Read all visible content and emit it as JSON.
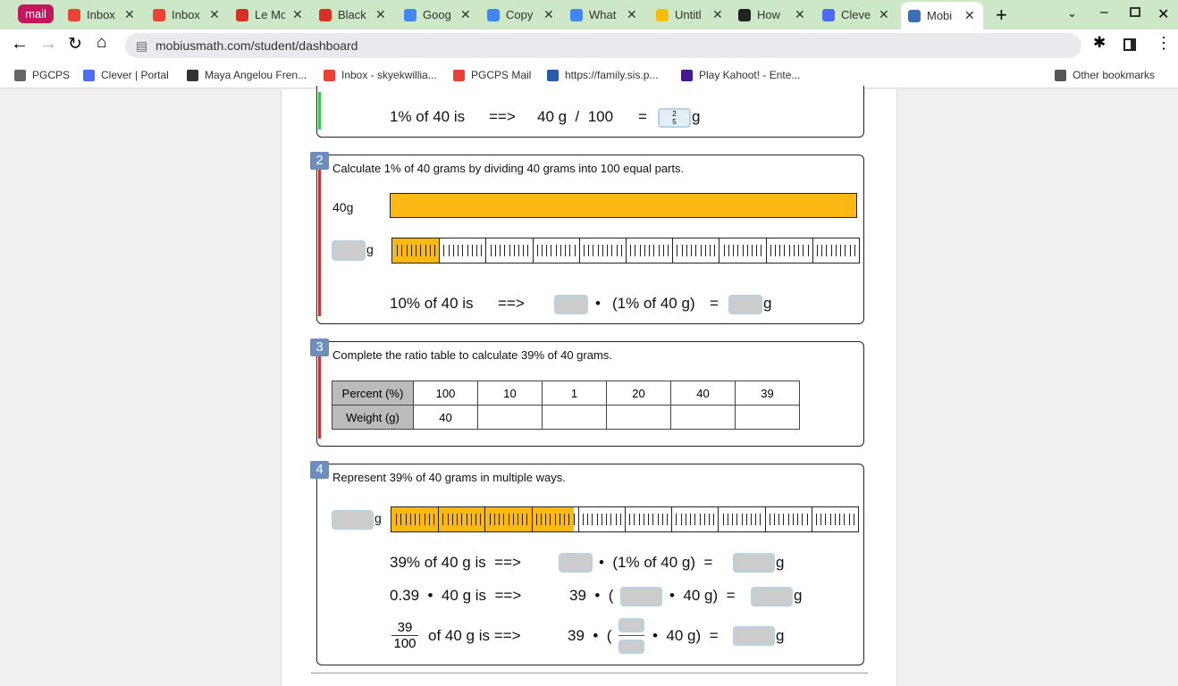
{
  "browser": {
    "pinned_tab": "mail",
    "tabs": [
      {
        "label": "Inbox",
        "color": "#ea4335"
      },
      {
        "label": "Inbox",
        "color": "#ea4335"
      },
      {
        "label": "Le Mo",
        "color": "#d93025"
      },
      {
        "label": "Black",
        "color": "#d93025"
      },
      {
        "label": "Goog",
        "color": "#4285f4"
      },
      {
        "label": "Copy",
        "color": "#4285f4"
      },
      {
        "label": "What",
        "color": "#4285f4"
      },
      {
        "label": "Untitl",
        "color": "#fbbc04"
      },
      {
        "label": "How",
        "color": "#222222"
      },
      {
        "label": "Cleve",
        "color": "#4a6cf7"
      },
      {
        "label": "Mobi",
        "color": "#3b6fb6",
        "active": true
      }
    ],
    "url": "mobiusmath.com/student/dashboard",
    "bookmarks": [
      {
        "label": "PGCPS",
        "color": "#666666"
      },
      {
        "label": "Clever | Portal",
        "color": "#4a6cf7"
      },
      {
        "label": "Maya Angelou Fren...",
        "color": "#333333"
      },
      {
        "label": "Inbox - skyekwillia...",
        "color": "#ea4335"
      },
      {
        "label": "PGCPS Mail",
        "color": "#ea4335"
      },
      {
        "label": "https://family.sis.p...",
        "color": "#2a5caa"
      },
      {
        "label": "Play Kahoot! - Ente...",
        "color": "#46178f"
      }
    ],
    "other_bookmarks": "Other bookmarks"
  },
  "q1": {
    "eq_left": "1% of 40 is",
    "arrow": "==>",
    "eq_mid": "40 g  /  100",
    "equals": "=",
    "answer_num": "2",
    "answer_den": "5",
    "unit": "g"
  },
  "q2": {
    "number": "2",
    "prompt": "Calculate 1% of 40 grams by dividing 40 grams into 100 equal parts.",
    "whole_label": "40g",
    "unit": "g",
    "tape_fill_percent": 10,
    "eq_left": "10% of 40 is",
    "arrow": "==>",
    "dot": "•",
    "eq_mid": "(1% of 40 g)",
    "equals": "="
  },
  "q3": {
    "number": "3",
    "prompt": "Complete the ratio table to calculate 39% of 40 grams.",
    "row1": {
      "header": "Percent (%)",
      "cells": [
        "100",
        "10",
        "1",
        "20",
        "40",
        "39"
      ]
    },
    "row2": {
      "header": "Weight (g)",
      "cells": [
        "40",
        "",
        "",
        "",
        "",
        ""
      ]
    }
  },
  "q4": {
    "number": "4",
    "prompt": "Represent 39% of 40 grams in multiple ways.",
    "unit": "g",
    "tape_fill_percent": 39,
    "line1_left": "39% of 40 g is  ==>",
    "line1_mid": "•  (1% of 40 g)  =",
    "line2_left": "0.39  •  40 g is  ==>",
    "line2_a": "39  •  (",
    "line2_b": "•  40 g)  =",
    "line3_num": "39",
    "line3_den": "100",
    "line3_left": "of 40 g is ==>",
    "line3_a": "39  •  (",
    "line3_b": "•  40 g)  ="
  },
  "colors": {
    "accent": "#fdb913",
    "correct": "#2ecc40",
    "incorrect": "#d32f2f",
    "badge": "#6c8ebf"
  }
}
